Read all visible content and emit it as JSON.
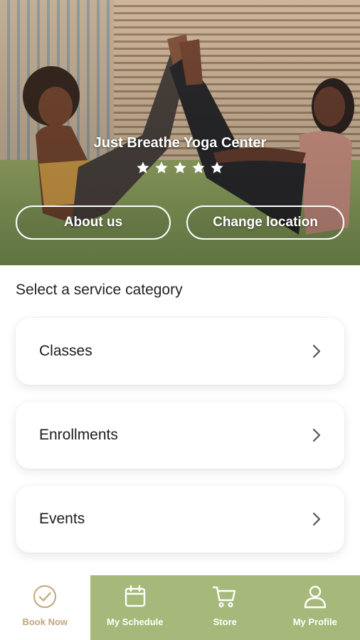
{
  "hero": {
    "title": "Just Breathe Yoga Center",
    "rating": 5,
    "buttons": {
      "about": "About us",
      "change_location": "Change location"
    }
  },
  "section_label": "Select a service category",
  "categories": [
    {
      "label": "Classes"
    },
    {
      "label": "Enrollments"
    },
    {
      "label": "Events"
    }
  ],
  "tabs": [
    {
      "label": "Book Now",
      "icon": "check-circle-icon",
      "active": true
    },
    {
      "label": "My Schedule",
      "icon": "calendar-icon",
      "active": false
    },
    {
      "label": "Store",
      "icon": "cart-icon",
      "active": false
    },
    {
      "label": "My Profile",
      "icon": "user-icon",
      "active": false
    }
  ],
  "colors": {
    "tab_bar": "#a6b97a",
    "active_tab_text": "#c2a679"
  }
}
